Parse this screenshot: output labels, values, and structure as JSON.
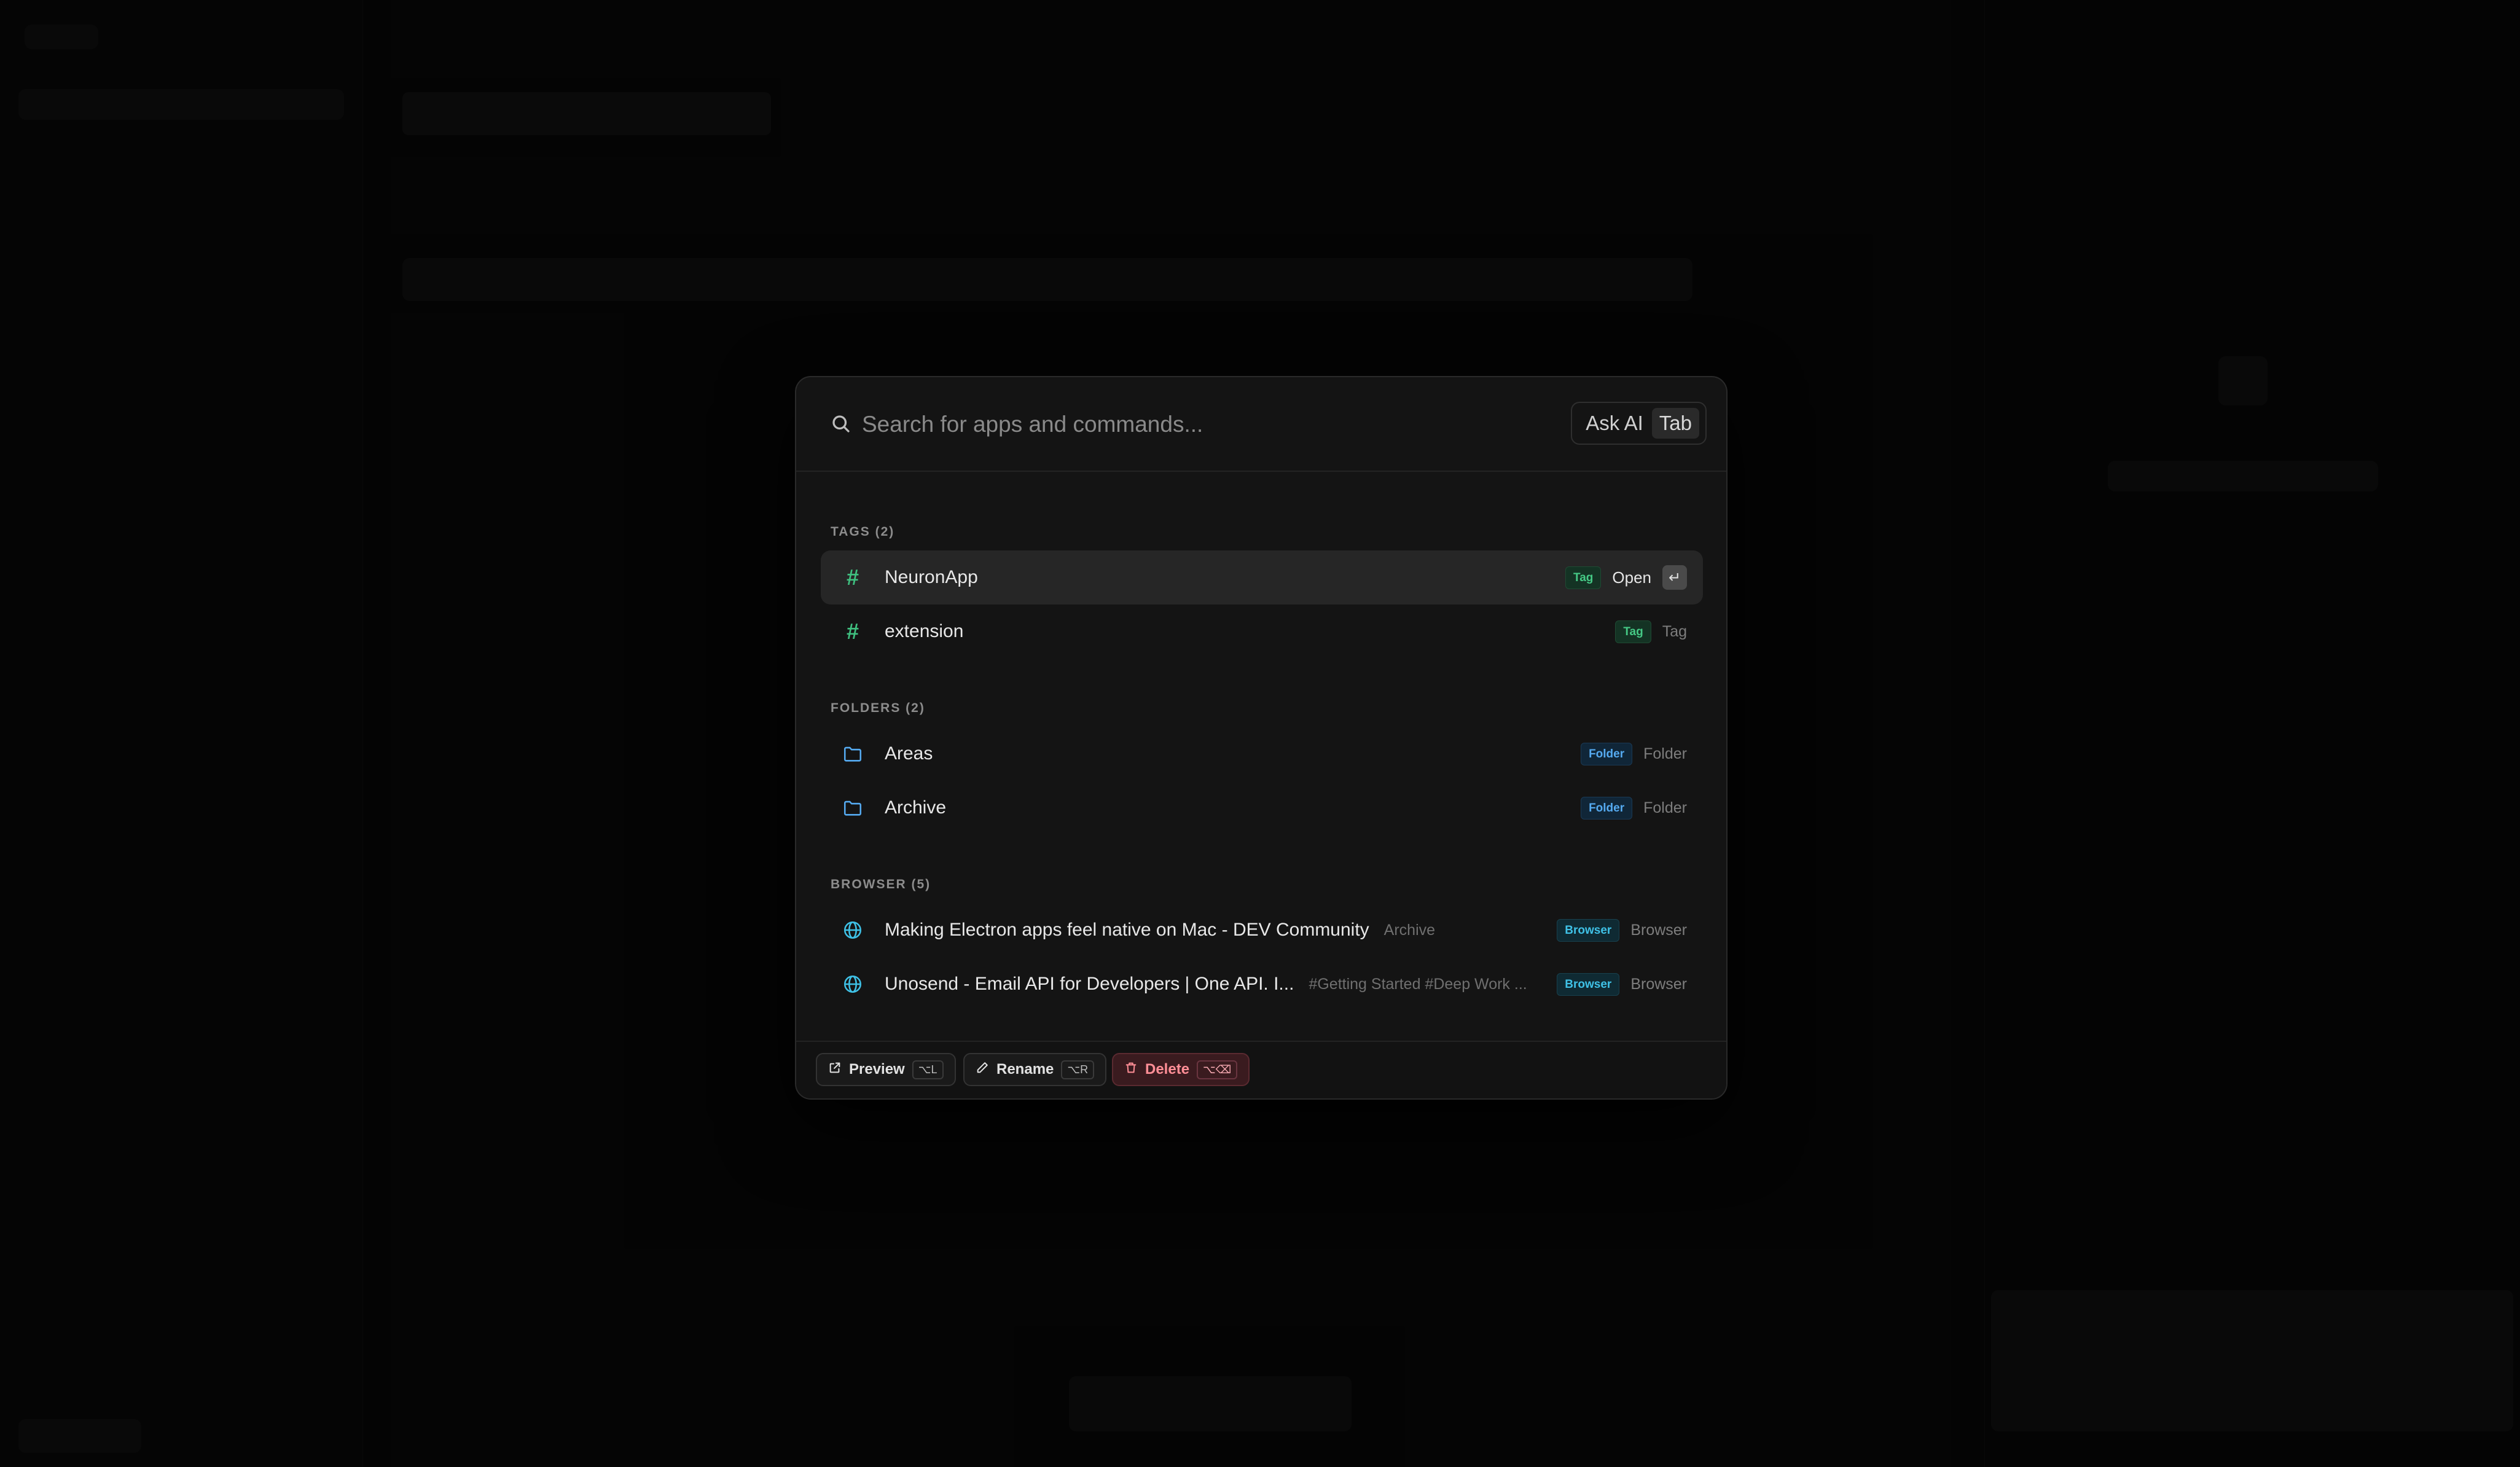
{
  "search": {
    "placeholder": "Search for apps and commands...",
    "ask_ai_label": "Ask AI",
    "ask_ai_key": "Tab"
  },
  "sections": {
    "tags": {
      "label": "TAGS (2)",
      "items": [
        {
          "title": "NeuronApp",
          "badge": "Tag",
          "action": "Open",
          "enter_key": "↵"
        },
        {
          "title": "extension",
          "badge": "Tag",
          "type": "Tag"
        }
      ]
    },
    "folders": {
      "label": "FOLDERS (2)",
      "items": [
        {
          "title": "Areas",
          "badge": "Folder",
          "type": "Folder"
        },
        {
          "title": "Archive",
          "badge": "Folder",
          "type": "Folder"
        }
      ]
    },
    "browser": {
      "label": "BROWSER (5)",
      "items": [
        {
          "title": "Making Electron apps feel native on Mac - DEV Community",
          "subtitle": "Archive",
          "badge": "Browser",
          "type": "Browser"
        },
        {
          "title": "Unosend - Email API for Developers | One API. I...",
          "subtitle": "#Getting Started #Deep Work ...",
          "badge": "Browser",
          "type": "Browser"
        }
      ]
    }
  },
  "footer": {
    "preview_label": "Preview",
    "preview_key": "⌥L",
    "rename_label": "Rename",
    "rename_key": "⌥R",
    "delete_label": "Delete",
    "delete_key": "⌥⌫"
  },
  "colors": {
    "tag_accent": "#3fbf7f",
    "folder_accent": "#55aaf0",
    "browser_accent": "#3fc1e6",
    "danger": "#ff8e96"
  },
  "icons": {
    "search": "search-icon",
    "tag": "hash-icon",
    "folder": "folder-icon",
    "browser": "globe-icon",
    "preview": "external-link-icon",
    "rename": "pencil-icon",
    "delete": "trash-icon"
  }
}
